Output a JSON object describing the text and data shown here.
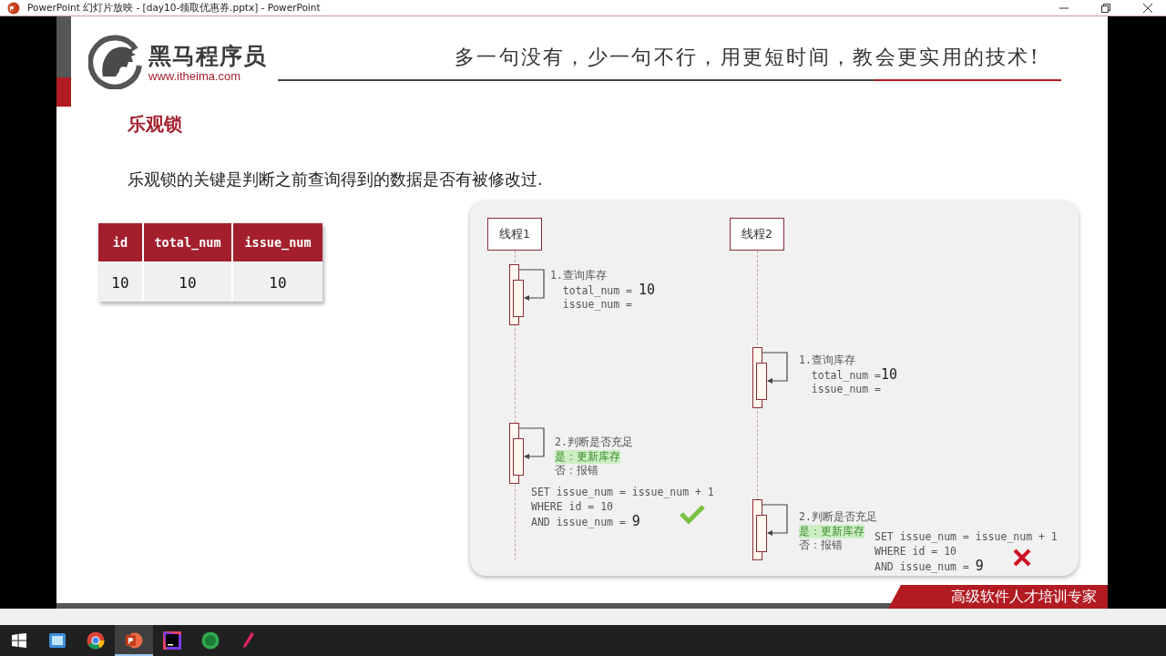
{
  "window": {
    "title": "PowerPoint 幻灯片放映 - [day10-领取优惠券.pptx] - PowerPoint"
  },
  "slide": {
    "brand": {
      "name": "黑马程序员",
      "url": "www.itheima.com"
    },
    "slogan": "多一句没有，少一句不行，用更短时间，教会更实用的技术!",
    "title": "乐观锁",
    "text": "乐观锁的关键是判断之前查询得到的数据是否有被修改过.",
    "table": {
      "columns": [
        "id",
        "total_num",
        "issue_num"
      ],
      "rows": [
        [
          "10",
          "10",
          "10"
        ]
      ]
    },
    "diagram": {
      "threads": [
        "线程1",
        "线程2"
      ],
      "blocks": [
        {
          "kind": "query",
          "lines": [
            {
              "text": "1.查询库存",
              "highlighted": false
            },
            {
              "text": "  total_num = ",
              "value": "10",
              "highlighted": false
            },
            {
              "text": "  issue_num =",
              "highlighted": false
            }
          ]
        },
        {
          "kind": "query",
          "lines": [
            {
              "text": "1.查询库存",
              "highlighted": false
            },
            {
              "text": "  total_num =",
              "value": "10",
              "highlighted": false
            },
            {
              "text": "  issue_num =",
              "highlighted": false
            }
          ]
        },
        {
          "kind": "check",
          "lines": [
            {
              "text": "2.判断是否充足",
              "highlighted": false
            },
            {
              "text": "是：更新库存",
              "highlighted": true
            },
            {
              "text": "否：报错",
              "highlighted": false
            }
          ],
          "sql": [
            {
              "text": "SET issue_num = issue_num + 1"
            },
            {
              "text": "WHERE id = 10"
            },
            {
              "text": "AND issue_num = ",
              "value": "9"
            }
          ],
          "passed": true
        },
        {
          "kind": "check",
          "lines": [
            {
              "text": "2.判断是否充足",
              "highlighted": false
            },
            {
              "text": "是：更新库存",
              "highlighted": true
            },
            {
              "text": "否：报错",
              "highlighted": false
            }
          ],
          "sql": [
            {
              "text": "SET issue_num = issue_num + 1"
            },
            {
              "text": "WHERE id = 10"
            },
            {
              "text": "AND issue_num = ",
              "value": "9"
            }
          ],
          "passed": false
        }
      ]
    },
    "footer": "高级软件人才培训专家"
  },
  "taskbar": {
    "apps": [
      {
        "kind": "start",
        "selected": false
      },
      {
        "kind": "tablet",
        "selected": false
      },
      {
        "kind": "chrome",
        "selected": false
      },
      {
        "kind": "powerpoint",
        "selected": true
      },
      {
        "kind": "intellij",
        "selected": false
      },
      {
        "kind": "hs",
        "selected": false
      },
      {
        "kind": "pen",
        "selected": false
      }
    ]
  }
}
